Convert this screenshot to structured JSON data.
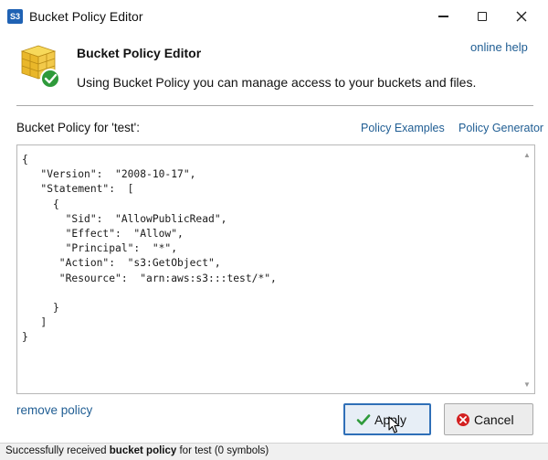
{
  "window": {
    "icon_text": "S3",
    "title": "Bucket Policy Editor"
  },
  "header": {
    "title": "Bucket Policy Editor",
    "description": "Using Bucket Policy you can manage access to your buckets and files.",
    "online_help": "online help"
  },
  "policy": {
    "label": "Bucket Policy for 'test':",
    "examples_link": "Policy Examples",
    "generator_link": "Policy Generator",
    "content": "{\n   \"Version\":  \"2008-10-17\",\n   \"Statement\":  [\n     {\n       \"Sid\":  \"AllowPublicRead\",\n       \"Effect\":  \"Allow\",\n       \"Principal\":  \"*\",\n      \"Action\":  \"s3:GetObject\",\n      \"Resource\":  \"arn:aws:s3:::test/*\",\n\n     }\n   ]\n}"
  },
  "actions": {
    "remove_policy": "remove policy",
    "apply": "Apply",
    "cancel": "Cancel"
  },
  "status": {
    "prefix": "Successfully received ",
    "bold": "bucket policy",
    "suffix": " for test (0 symbols)"
  },
  "colors": {
    "link": "#1f5d93",
    "apply_border": "#2f6fb7",
    "check_green": "#2e9a3a",
    "cancel_red": "#d32020"
  }
}
